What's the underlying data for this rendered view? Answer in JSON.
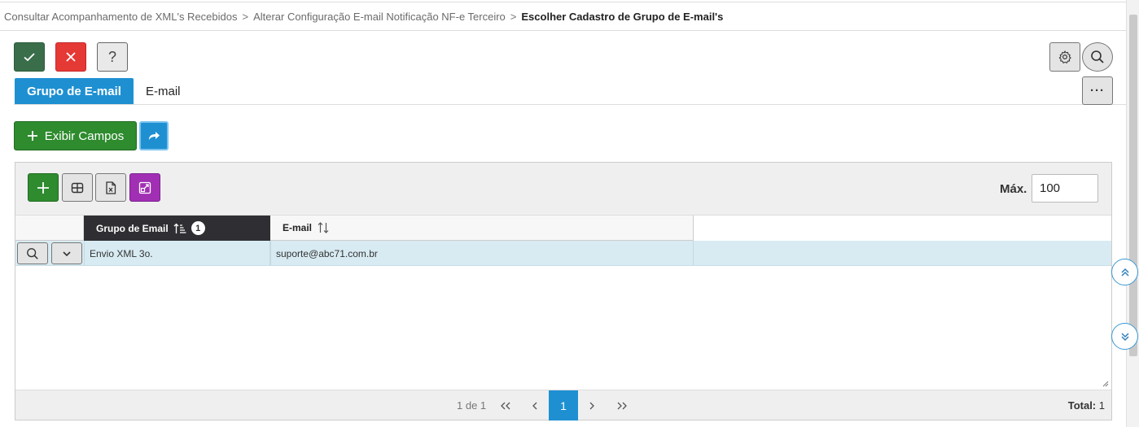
{
  "breadcrumb": {
    "items": [
      "Consultar Acompanhamento de XML's Recebidos",
      "Alterar Configuração E-mail Notificação NF-e Terceiro"
    ],
    "separator": ">",
    "current": "Escolher Cadastro de Grupo de E-mail's"
  },
  "toolbar": {
    "confirm_icon": "check-icon",
    "cancel_icon": "close-icon",
    "help_label": "?",
    "settings_icon": "gear-icon",
    "search_icon": "search-icon"
  },
  "tabs": [
    {
      "label": "Grupo de E-mail",
      "active": true
    },
    {
      "label": "E-mail",
      "active": false
    }
  ],
  "more_label": "···",
  "actions": {
    "exibir_label": "Exibir Campos",
    "exibir_icon": "plus-icon",
    "share_icon": "share-icon"
  },
  "grid": {
    "max_label": "Máx.",
    "max_value": "100",
    "columns": [
      {
        "label": "Grupo de Email",
        "sort": "ascending",
        "sort_order": "1"
      },
      {
        "label": "E-mail",
        "sort": "none"
      }
    ],
    "rows": [
      {
        "grupo": "Envio XML 3o.",
        "email": "suporte@abc71.com.br"
      }
    ]
  },
  "pager": {
    "info": "1 de 1",
    "current_page": "1",
    "total_label": "Total:",
    "total_value": "1"
  },
  "colors": {
    "primary": "#1e90d2",
    "success": "#2e8b2e",
    "confirm": "#3a6e4b",
    "danger": "#e53935",
    "purple": "#a12fb3",
    "header_dark": "#2f2f33",
    "row_selected": "#d8ebf2"
  }
}
